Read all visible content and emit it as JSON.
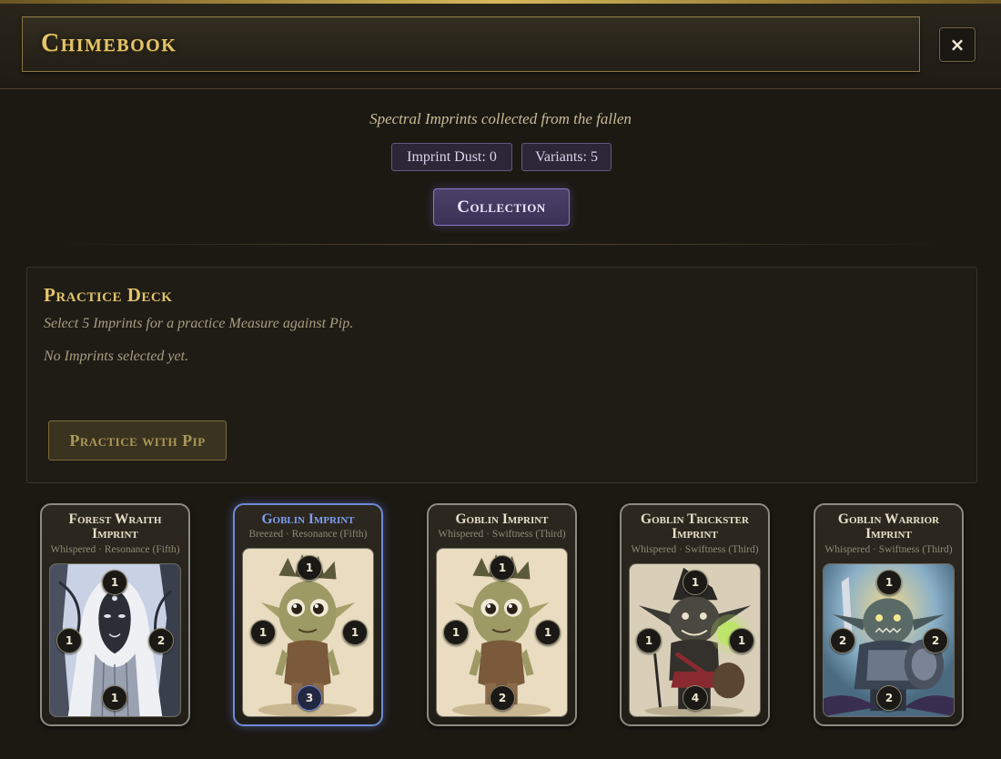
{
  "window": {
    "title": "Chimebook",
    "close_label": "×"
  },
  "header": {
    "subtitle": "Spectral Imprints collected from the fallen",
    "stats": {
      "dust_label": "Imprint Dust: 0",
      "variants_label": "Variants: 5"
    },
    "collection_button": "Collection"
  },
  "practice": {
    "title": "Practice Deck",
    "description": "Select 5 Imprints for a practice Measure against Pip.",
    "empty_text": "No Imprints selected yet.",
    "button_label": "Practice with Pip"
  },
  "cards": [
    {
      "name": "Forest Wraith Imprint",
      "subtitle": "Whispered · Resonance (Fifth)",
      "selected": false,
      "stats": {
        "top": "1",
        "left": "1",
        "right": "2",
        "bottom": "1"
      },
      "art": "forest-wraith-icon"
    },
    {
      "name": "Goblin Imprint",
      "subtitle": "Breezed · Resonance (Fifth)",
      "selected": true,
      "stats": {
        "top": "1",
        "left": "1",
        "right": "1",
        "bottom": "3"
      },
      "art": "goblin-icon"
    },
    {
      "name": "Goblin Imprint",
      "subtitle": "Whispered · Swiftness (Third)",
      "selected": false,
      "stats": {
        "top": "1",
        "left": "1",
        "right": "1",
        "bottom": "2"
      },
      "art": "goblin-icon"
    },
    {
      "name": "Goblin Trickster Imprint",
      "subtitle": "Whispered · Swiftness (Third)",
      "selected": false,
      "stats": {
        "top": "1",
        "left": "1",
        "right": "1",
        "bottom": "4"
      },
      "art": "goblin-trickster-icon"
    },
    {
      "name": "Goblin Warrior Imprint",
      "subtitle": "Whispered · Swiftness (Third)",
      "selected": false,
      "stats": {
        "top": "1",
        "left": "2",
        "right": "2",
        "bottom": "2"
      },
      "art": "goblin-warrior-icon"
    }
  ],
  "colors": {
    "gold_accent": "#e3c46a",
    "purple_accent": "#8a77c4",
    "selected_blue": "#6f8ad8",
    "background": "#1c1913"
  }
}
